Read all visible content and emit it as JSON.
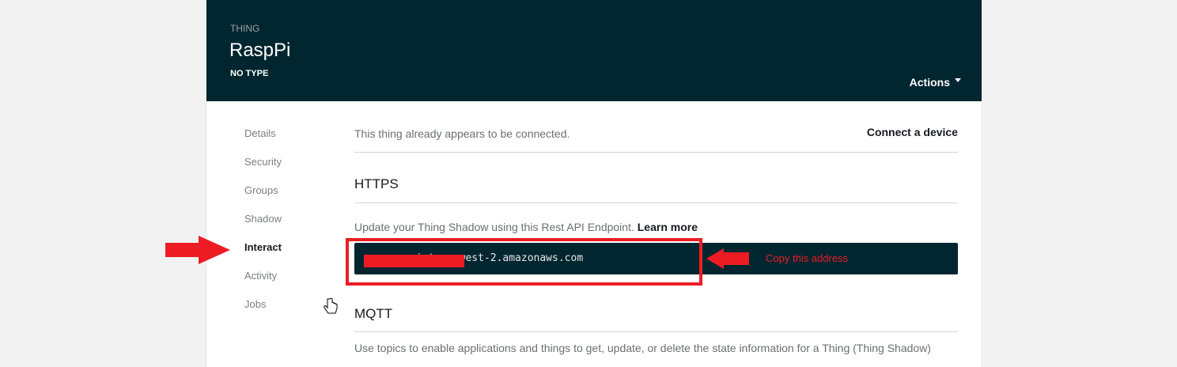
{
  "header": {
    "kind": "THING",
    "title": "RaspPi",
    "type": "NO TYPE",
    "actions": "Actions"
  },
  "nav": [
    "Details",
    "Security",
    "Groups",
    "Shadow",
    "Interact",
    "Activity",
    "Jobs"
  ],
  "main": {
    "connected_text": "This thing already appears to be connected.",
    "connect_link": "Connect a device",
    "https_title": "HTTPS",
    "https_desc": "Update your Thing Shadow using this Rest API Endpoint.",
    "learn_more": "Learn more",
    "endpoint": ".iot.us-west-2.amazonaws.com",
    "mqtt_title": "MQTT",
    "mqtt_desc": "Use topics to enable applications and things to get, update, or delete the state information for a Thing (Thing Shadow)"
  },
  "annotation": {
    "note": "Copy this address",
    "color": "#ed1c24"
  }
}
